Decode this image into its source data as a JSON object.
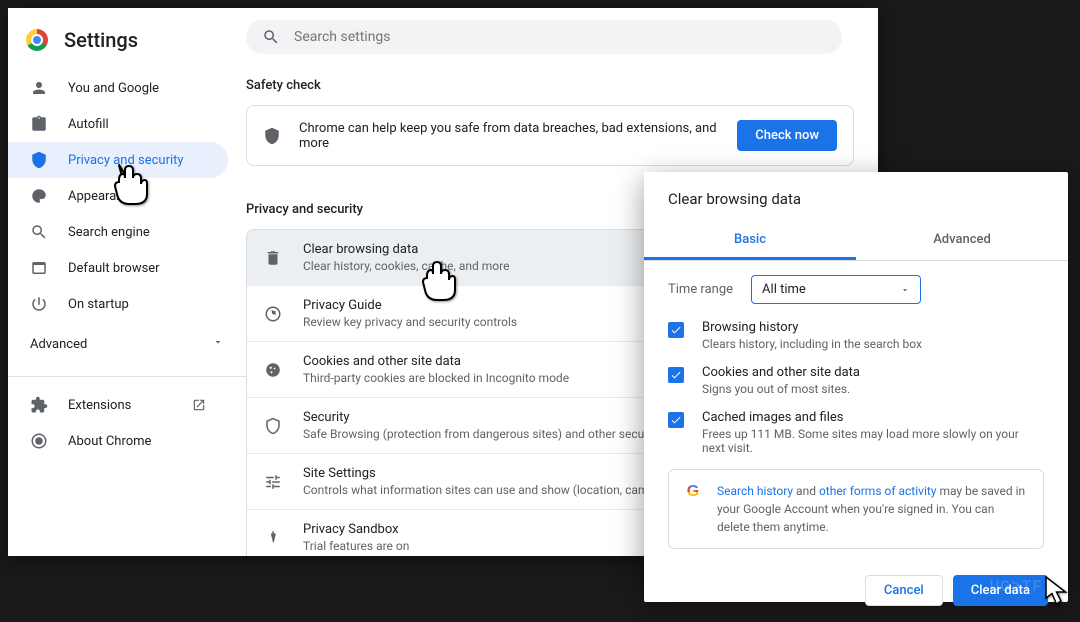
{
  "header": {
    "title": "Settings"
  },
  "search": {
    "placeholder": "Search settings"
  },
  "sidebar": {
    "items": [
      {
        "label": "You and Google"
      },
      {
        "label": "Autofill"
      },
      {
        "label": "Privacy and security"
      },
      {
        "label": "Appearance"
      },
      {
        "label": "Search engine"
      },
      {
        "label": "Default browser"
      },
      {
        "label": "On startup"
      }
    ],
    "advanced": "Advanced",
    "footer": [
      {
        "label": "Extensions"
      },
      {
        "label": "About Chrome"
      }
    ]
  },
  "safety": {
    "section_label": "Safety check",
    "text": "Chrome can help keep you safe from data breaches, bad extensions, and more",
    "button": "Check now"
  },
  "privacy": {
    "section_label": "Privacy and security",
    "items": [
      {
        "title": "Clear browsing data",
        "sub": "Clear history, cookies, cache, and more"
      },
      {
        "title": "Privacy Guide",
        "sub": "Review key privacy and security controls"
      },
      {
        "title": "Cookies and other site data",
        "sub": "Third-party cookies are blocked in Incognito mode"
      },
      {
        "title": "Security",
        "sub": "Safe Browsing (protection from dangerous sites) and other security settings"
      },
      {
        "title": "Site Settings",
        "sub": "Controls what information sites can use and show (location, camera, pop-ups, and more)"
      },
      {
        "title": "Privacy Sandbox",
        "sub": "Trial features are on"
      }
    ]
  },
  "dialog": {
    "title": "Clear browsing data",
    "tabs": {
      "basic": "Basic",
      "advanced": "Advanced"
    },
    "time_label": "Time range",
    "time_value": "All time",
    "checks": [
      {
        "title": "Browsing history",
        "sub": "Clears history, including in the search box"
      },
      {
        "title": "Cookies and other site data",
        "sub": "Signs you out of most sites."
      },
      {
        "title": "Cached images and files",
        "sub": "Frees up 111 MB. Some sites may load more slowly on your next visit."
      }
    ],
    "info": {
      "link1": "Search history",
      "mid1": " and ",
      "link2": "other forms of activity",
      "rest": " may be saved in your Google Account when you're signed in. You can delete them anytime."
    },
    "cancel": "Cancel",
    "clear": "Clear data"
  },
  "watermark": "UG≥TFIX"
}
